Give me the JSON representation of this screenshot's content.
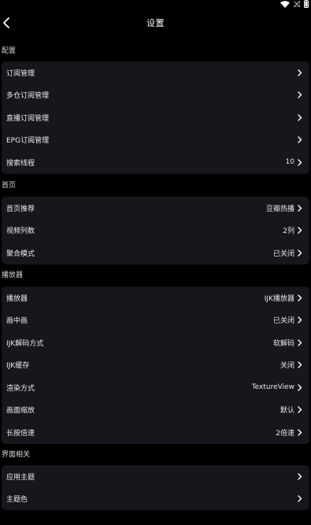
{
  "status_bar": {
    "icons": [
      "wifi-icon",
      "signal-icon",
      "battery-icon"
    ]
  },
  "header": {
    "title": "设置",
    "back_icon": "chevron-left-icon"
  },
  "sections": [
    {
      "title": "配置",
      "items": [
        {
          "label": "订阅管理",
          "value": ""
        },
        {
          "label": "多仓订阅管理",
          "value": ""
        },
        {
          "label": "直播订阅管理",
          "value": ""
        },
        {
          "label": "EPG订阅管理",
          "value": ""
        },
        {
          "label": "搜索线程",
          "value": "10"
        }
      ]
    },
    {
      "title": "首页",
      "items": [
        {
          "label": "首页推荐",
          "value": "豆瓣热播"
        },
        {
          "label": "视频列数",
          "value": "2列"
        },
        {
          "label": "聚合模式",
          "value": "已关闭"
        }
      ]
    },
    {
      "title": "播放器",
      "items": [
        {
          "label": "播放器",
          "value": "IJK播放器"
        },
        {
          "label": "画中画",
          "value": "已关闭"
        },
        {
          "label": "IJK解码方式",
          "value": "软解码"
        },
        {
          "label": "IJK缓存",
          "value": "关闭"
        },
        {
          "label": "渲染方式",
          "value": "TextureView"
        },
        {
          "label": "画面缩放",
          "value": "默认"
        },
        {
          "label": "长按倍速",
          "value": "2倍速"
        }
      ]
    },
    {
      "title": "界面相关",
      "items": [
        {
          "label": "应用主题",
          "value": ""
        },
        {
          "label": "主题色",
          "value": ""
        }
      ]
    }
  ],
  "colors": {
    "background": "#000000",
    "card": "#16171c",
    "text": "#ececec"
  }
}
